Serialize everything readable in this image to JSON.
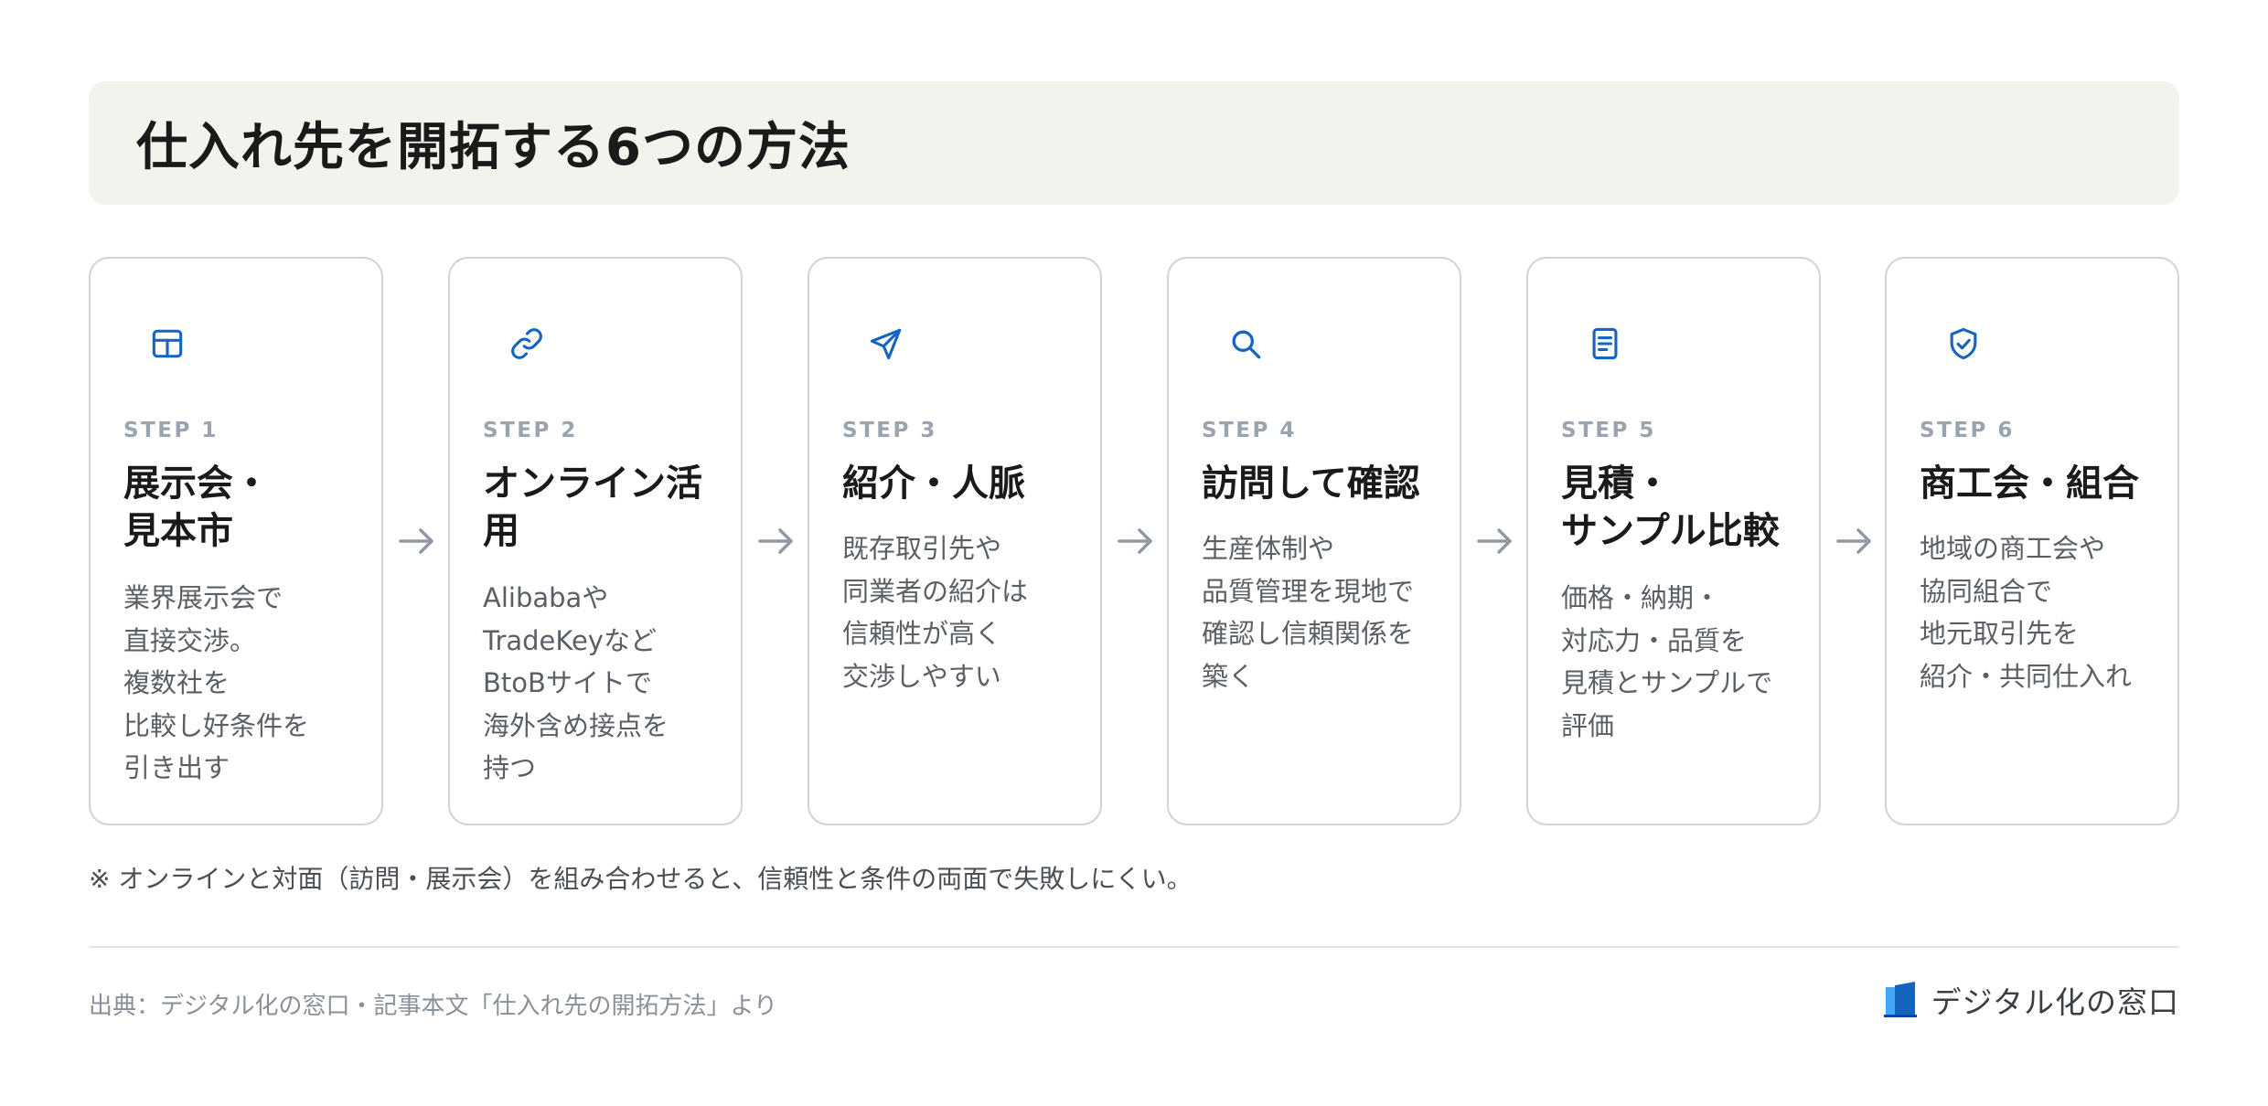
{
  "title": "仕入れ先を開拓する6つの方法",
  "accent_color": "#1565c0",
  "steps": [
    {
      "step_label": "STEP 1",
      "heading": "展示会・\n見本市",
      "description": "業界展示会で\n直接交渉。\n複数社を\n比較し好条件を\n引き出す",
      "icon": "table-icon"
    },
    {
      "step_label": "STEP 2",
      "heading": "オンライン活\n用",
      "description": "Alibabaや\nTradeKeyなど\nBtoBサイトで\n海外含め接点を\n持つ",
      "icon": "link-icon"
    },
    {
      "step_label": "STEP 3",
      "heading": "紹介・人脈",
      "description": "既存取引先や\n同業者の紹介は\n信頼性が高く\n交渉しやすい",
      "icon": "send-icon"
    },
    {
      "step_label": "STEP 4",
      "heading": "訪問して確認",
      "description": "生産体制や\n品質管理を現地で\n確認し信頼関係を\n築く",
      "icon": "search-icon"
    },
    {
      "step_label": "STEP 5",
      "heading": "見積・\nサンプル比較",
      "description": "価格・納期・\n対応力・品質を\n見積とサンプルで\n評価",
      "icon": "document-icon"
    },
    {
      "step_label": "STEP 6",
      "heading": "商工会・組合",
      "description": "地域の商工会や\n協同組合で\n地元取引先を\n紹介・共同仕入れ",
      "icon": "shield-check-icon"
    }
  ],
  "note": "※ オンラインと対面（訪問・展示会）を組み合わせると、信頼性と条件の両面で失敗しにくい。",
  "source": "出典：デジタル化の窓口・記事本文「仕入れ先の開拓方法」より",
  "logo_text": "デジタル化の窓口"
}
